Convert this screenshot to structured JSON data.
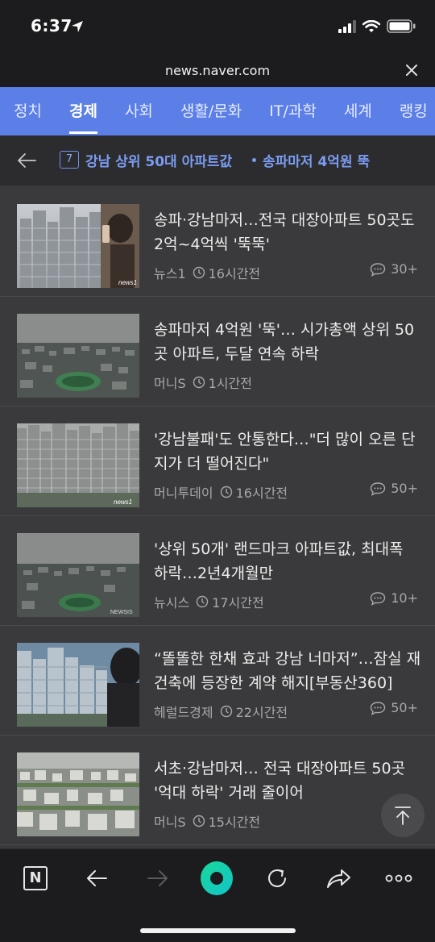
{
  "status": {
    "time": "6:37"
  },
  "url_bar": {
    "url": "news.naver.com"
  },
  "nav": {
    "tabs": [
      {
        "label": "정치",
        "active": false
      },
      {
        "label": "경제",
        "active": true
      },
      {
        "label": "사회",
        "active": false
      },
      {
        "label": "생활/문화",
        "active": false
      },
      {
        "label": "IT/과학",
        "active": false
      },
      {
        "label": "세계",
        "active": false
      },
      {
        "label": "랭킹",
        "active": false
      }
    ]
  },
  "topic": {
    "number": "7",
    "title": "강남 상위 50대 아파트값",
    "subtitle": "송파마저 4억원 뚝"
  },
  "news": [
    {
      "headline": "송파·강남마저…전국 대장아파트 50곳도 2억~4억씩 '뚝뚝'",
      "source": "뉴스1",
      "time": "16시간전",
      "comments": "30+"
    },
    {
      "headline": "송파마저 4억원 '뚝'… 시가총액 상위 50곳 아파트, 두달 연속 하락",
      "source": "머니S",
      "time": "1시간전",
      "comments": ""
    },
    {
      "headline": "'강남불패'도 안통한다…\"더 많이 오른 단지가 더 떨어진다\"",
      "source": "머니투데이",
      "time": "16시간전",
      "comments": "50+"
    },
    {
      "headline": "'상위 50개' 랜드마크 아파트값, 최대폭 하락…2년4개월만",
      "source": "뉴시스",
      "time": "17시간전",
      "comments": "10+"
    },
    {
      "headline": "“똘똘한 한채 효과 강남 너마저”…잠실 재건축에 등장한 계약 해지[부동산360]",
      "source": "헤럴드경제",
      "time": "22시간전",
      "comments": "50+"
    },
    {
      "headline": "서초·강남마저… 전국 대장아파트 50곳 '억대 하락' 거래 줄이어",
      "source": "머니S",
      "time": "15시간전",
      "comments": ""
    }
  ],
  "thumb_watermarks": [
    "news1",
    "",
    "news1",
    "NEWSIS",
    "",
    ""
  ],
  "icons": {
    "location": "location-arrow-icon",
    "signal": "cellular-signal-icon",
    "wifi": "wifi-icon",
    "battery": "battery-icon",
    "close": "close-icon",
    "back": "back-arrow-icon",
    "clock": "clock-icon",
    "comment": "comment-bubble-icon",
    "scroll_top": "scroll-to-top-icon",
    "naver": "naver-n-icon",
    "browser_back": "browser-back-icon",
    "browser_forward": "browser-forward-icon",
    "green_dot": "naver-green-dot-icon",
    "refresh": "refresh-icon",
    "share": "share-icon",
    "more": "more-dots-icon"
  },
  "colors": {
    "nav_bg": "#5b7fe6",
    "topic_accent": "#7b9cf2",
    "background": "#3a3a3c",
    "bars": "#1c1c1e"
  }
}
